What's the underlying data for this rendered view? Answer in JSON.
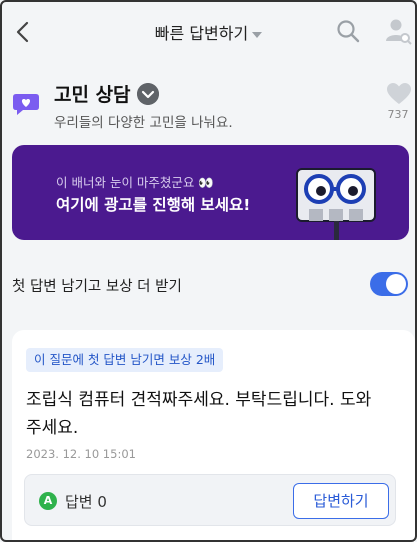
{
  "header": {
    "title": "빠른 답변하기",
    "icons": {
      "back": "chevron-left-icon",
      "search": "search-icon",
      "user": "user-search-icon"
    }
  },
  "board": {
    "name": "고민 상담",
    "description": "우리들의 다양한 고민을 나눠요.",
    "like_count": "737"
  },
  "banner": {
    "subtitle": "이 배너와 눈이 마주쳤군요 👀",
    "headline": "여기에 광고를 진행해 보세요!",
    "background": "#4b1a8f"
  },
  "reward_toggle": {
    "label": "첫 답변 남기고 보상 더 받기",
    "on": true,
    "color": "#3b6de8"
  },
  "question": {
    "tag": "이 질문에 첫 답변 남기면 보상 2배",
    "text": "조립식 컴퓨터 견적짜주세요. 부탁드립니다. 도와주세요.",
    "date": "2023. 12. 10 15:01",
    "answer_label": "답변 0",
    "answer_icon_letter": "A",
    "answer_button": "답변하기"
  }
}
